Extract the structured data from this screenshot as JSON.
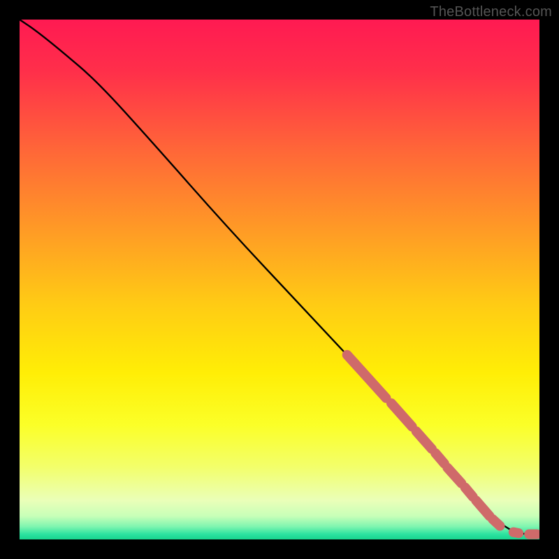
{
  "credit": "TheBottleneck.com",
  "chart_data": {
    "type": "line",
    "title": "",
    "xlabel": "",
    "ylabel": "",
    "xlim": [
      0,
      100
    ],
    "ylim": [
      0,
      100
    ],
    "grid": false,
    "series": [
      {
        "name": "curve",
        "x": [
          0,
          3,
          8,
          15,
          25,
          40,
          55,
          70,
          82,
          90,
          94,
          96,
          98,
          100
        ],
        "y": [
          100,
          98,
          94,
          88,
          77,
          60,
          44,
          28,
          14,
          5,
          2,
          1.2,
          1,
          1
        ]
      }
    ],
    "highlighted_segments": [
      {
        "x0": 63,
        "y0": 35.5,
        "x1": 70.5,
        "y1": 27.2
      },
      {
        "x0": 71.5,
        "y0": 26.2,
        "x1": 75.5,
        "y1": 21.7
      },
      {
        "x0": 76.3,
        "y0": 20.8,
        "x1": 79.3,
        "y1": 17.4
      },
      {
        "x0": 80.0,
        "y0": 16.6,
        "x1": 81.7,
        "y1": 14.6
      },
      {
        "x0": 82.3,
        "y0": 13.8,
        "x1": 85.0,
        "y1": 10.8
      },
      {
        "x0": 85.7,
        "y0": 10.0,
        "x1": 87.2,
        "y1": 8.2
      },
      {
        "x0": 87.8,
        "y0": 7.5,
        "x1": 90.4,
        "y1": 4.5
      },
      {
        "x0": 91.0,
        "y0": 3.9,
        "x1": 92.4,
        "y1": 2.6
      },
      {
        "x0": 95.0,
        "y0": 1.4,
        "x1": 96.0,
        "y1": 1.2
      },
      {
        "x0": 98.0,
        "y0": 1.0,
        "x1": 99.5,
        "y1": 1.0
      }
    ],
    "gradient_stops": [
      {
        "offset": 0,
        "color": "#ff1a52"
      },
      {
        "offset": 0.1,
        "color": "#ff2f4a"
      },
      {
        "offset": 0.25,
        "color": "#ff6638"
      },
      {
        "offset": 0.4,
        "color": "#ff9926"
      },
      {
        "offset": 0.55,
        "color": "#ffcc14"
      },
      {
        "offset": 0.68,
        "color": "#ffee06"
      },
      {
        "offset": 0.78,
        "color": "#fbff28"
      },
      {
        "offset": 0.86,
        "color": "#f3ff6a"
      },
      {
        "offset": 0.925,
        "color": "#eaffb8"
      },
      {
        "offset": 0.955,
        "color": "#c8ffb8"
      },
      {
        "offset": 0.975,
        "color": "#80f5b0"
      },
      {
        "offset": 0.99,
        "color": "#2ce3a0"
      },
      {
        "offset": 1.0,
        "color": "#18d48e"
      }
    ]
  },
  "colors": {
    "frame": "#000000",
    "curve": "#000000",
    "highlight": "#cf6a6a",
    "credit": "#555555"
  }
}
